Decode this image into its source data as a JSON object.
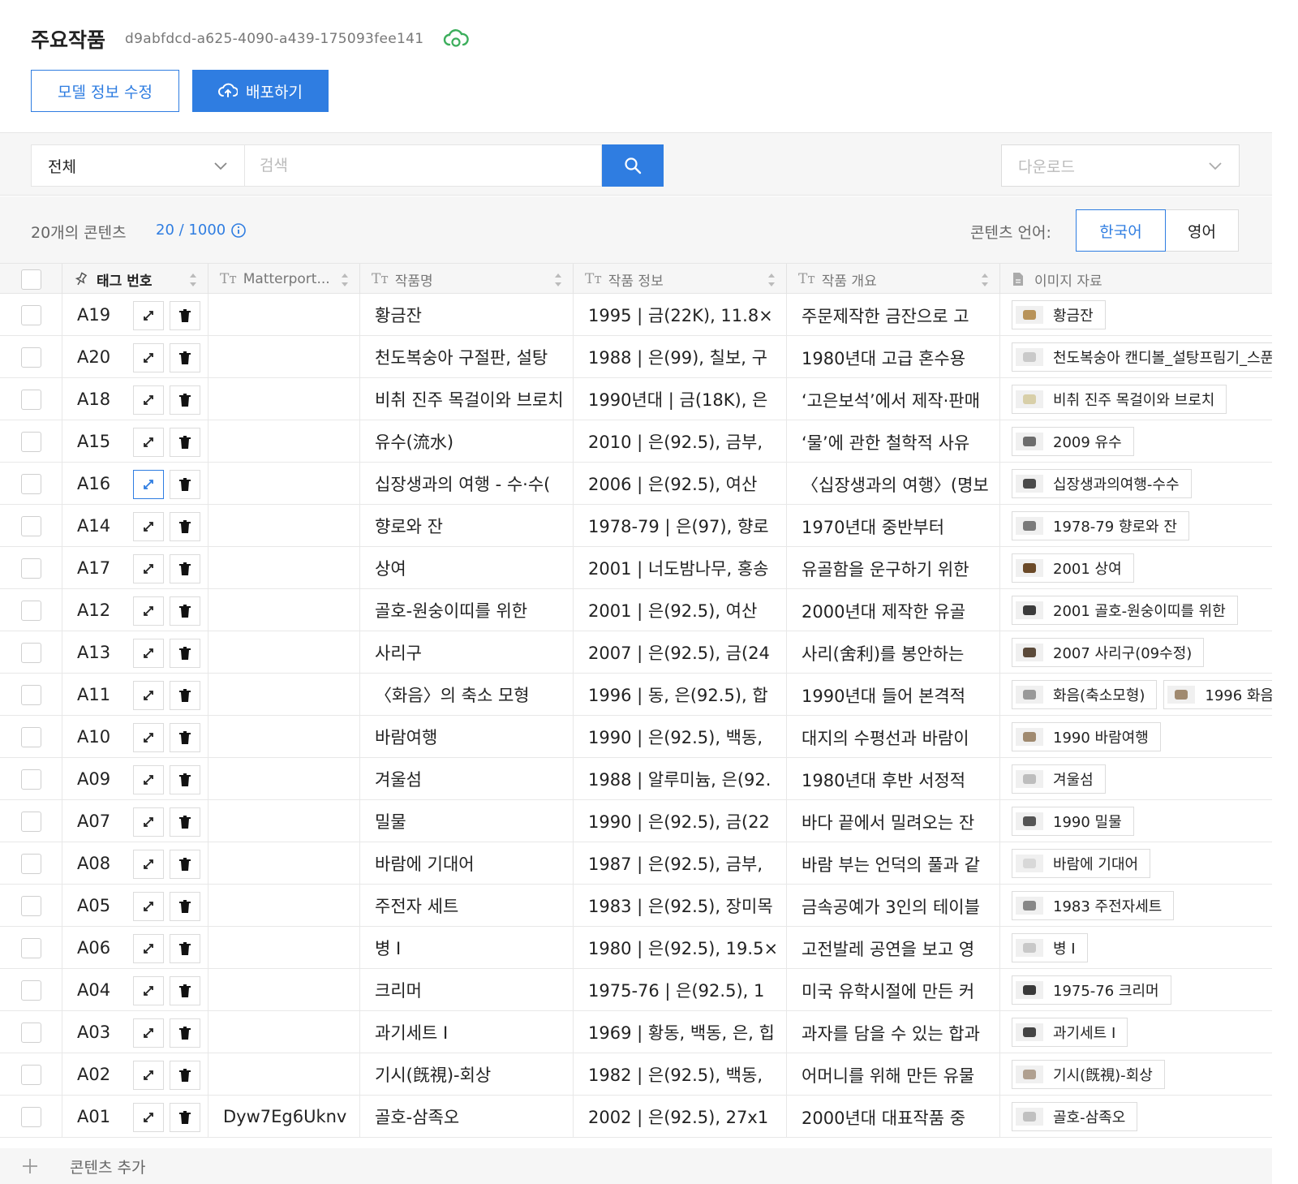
{
  "header": {
    "title": "주요작품",
    "model_id": "d9abfdcd-a625-4090-a439-175093fee141",
    "edit_button": "모델 정보 수정",
    "deploy_button": "배포하기"
  },
  "toolbar": {
    "filter_value": "전체",
    "search_placeholder": "검색",
    "download_placeholder": "다운로드"
  },
  "summary": {
    "count": "20개의 콘텐츠",
    "quota": "20 / 1000",
    "language_label": "콘텐츠 언어:",
    "lang_korean": "한국어",
    "lang_english": "영어"
  },
  "columns": {
    "tag": "태그 번호",
    "matterport": "Matterport...",
    "name": "작품명",
    "info": "작품 정보",
    "overview": "작품 개요",
    "images": "이미지 자료"
  },
  "rows": [
    {
      "tag": "A19",
      "matterport": "",
      "name": "황금잔",
      "info": "1995 | 금(22K), 11.8×",
      "overview": "주문제작한 금잔으로 고",
      "images": [
        "황금잔"
      ]
    },
    {
      "tag": "A20",
      "matterport": "",
      "name": "천도복숭아 구절판, 설탕",
      "info": "1988 | 은(99), 칠보, 구",
      "overview": "1980년대 고급 혼수용",
      "images": [
        "천도복숭아 캔디볼_설탕프림기_스푼"
      ]
    },
    {
      "tag": "A18",
      "matterport": "",
      "name": "비취 진주 목걸이와 브로치",
      "info": "1990년대 | 금(18K), 은",
      "overview": "‘고은보석’에서 제작·판매",
      "images": [
        "비취 진주 목걸이와 브로치"
      ]
    },
    {
      "tag": "A15",
      "matterport": "",
      "name": "유수(流水)",
      "info": "2010 | 은(92.5), 금부, ",
      "overview": "‘물’에 관한 철학적 사유",
      "images": [
        "2009 유수"
      ]
    },
    {
      "tag": "A16",
      "matterport": "",
      "name": "십장생과의 여행 - 수·수(",
      "info": "2006 | 은(92.5), 여산 ",
      "overview": "〈십장생과의 여행〉(명보",
      "images": [
        "십장생과의여행-수수"
      ]
    },
    {
      "tag": "A14",
      "matterport": "",
      "name": "향로와 잔",
      "info": "1978-79 | 은(97), 향로",
      "overview": "1970년대 중반부터",
      "images": [
        "1978-79 향로와 잔"
      ]
    },
    {
      "tag": "A17",
      "matterport": "",
      "name": "상여",
      "info": "2001 | 너도밤나무, 홍송",
      "overview": "유골함을 운구하기 위한",
      "images": [
        "2001 상여"
      ]
    },
    {
      "tag": "A12",
      "matterport": "",
      "name": "골호-원숭이띠를 위한",
      "info": "2001 | 은(92.5), 여산 ",
      "overview": "2000년대 제작한 유골",
      "images": [
        "2001 골호-원숭이띠를 위한"
      ]
    },
    {
      "tag": "A13",
      "matterport": "",
      "name": "사리구",
      "info": "2007 | 은(92.5), 금(24",
      "overview": "사리(舍利)를 봉안하는",
      "images": [
        "2007 사리구(09수정)"
      ]
    },
    {
      "tag": "A11",
      "matterport": "",
      "name": "〈화음〉의 축소 모형",
      "info": "1996 | 동, 은(92.5), 합",
      "overview": "1990년대 들어 본격적",
      "images": [
        "화음(축소모형)",
        "1996 화음"
      ]
    },
    {
      "tag": "A10",
      "matterport": "",
      "name": "바람여행",
      "info": "1990 | 은(92.5), 백동, ",
      "overview": "대지의 수평선과 바람이",
      "images": [
        "1990 바람여행"
      ]
    },
    {
      "tag": "A09",
      "matterport": "",
      "name": "겨울섬",
      "info": "1988 | 알루미늄, 은(92.",
      "overview": "1980년대 후반 서정적",
      "images": [
        "겨울섬"
      ]
    },
    {
      "tag": "A07",
      "matterport": "",
      "name": "밀물",
      "info": "1990 | 은(92.5), 금(22",
      "overview": "바다 끝에서 밀려오는 잔",
      "images": [
        "1990 밀물"
      ]
    },
    {
      "tag": "A08",
      "matterport": "",
      "name": "바람에 기대어",
      "info": "1987 | 은(92.5), 금부, ",
      "overview": "바람 부는 언덕의 풀과 같",
      "images": [
        "바람에 기대어"
      ]
    },
    {
      "tag": "A05",
      "matterport": "",
      "name": "주전자 세트",
      "info": "1983 | 은(92.5), 장미목",
      "overview": "금속공예가 3인의 테이블",
      "images": [
        "1983 주전자세트"
      ]
    },
    {
      "tag": "A06",
      "matterport": "",
      "name": "병 I",
      "info": "1980 | 은(92.5), 19.5×",
      "overview": "고전발레 공연을 보고 영",
      "images": [
        "병 I"
      ]
    },
    {
      "tag": "A04",
      "matterport": "",
      "name": "크리머",
      "info": "1975-76 | 은(92.5), 1",
      "overview": "미국 유학시절에 만든 커",
      "images": [
        "1975-76 크리머"
      ]
    },
    {
      "tag": "A03",
      "matterport": "",
      "name": "과기세트 I",
      "info": "1969 | 황동, 백동, 은, 힙",
      "overview": "과자를 담을 수 있는 합과",
      "images": [
        "과기세트 I"
      ]
    },
    {
      "tag": "A02",
      "matterport": "",
      "name": "기시(旣視)-회상",
      "info": "1982 | 은(92.5), 백동, ",
      "overview": "어머니를 위해 만든 유물",
      "images": [
        "기시(旣視)-회상"
      ]
    },
    {
      "tag": "A01",
      "matterport": "Dyw7Eg6Uknv",
      "name": "골호-삼족오",
      "info": "2002 | 은(92.5), 27x1",
      "overview": "2000년대 대표작품 중",
      "images": [
        "골호-삼족오"
      ]
    }
  ],
  "footer": {
    "add_label": "콘텐츠 추가"
  },
  "colors": {
    "accent": "#2f7de1",
    "cloud_icon": "#3cae5c"
  }
}
